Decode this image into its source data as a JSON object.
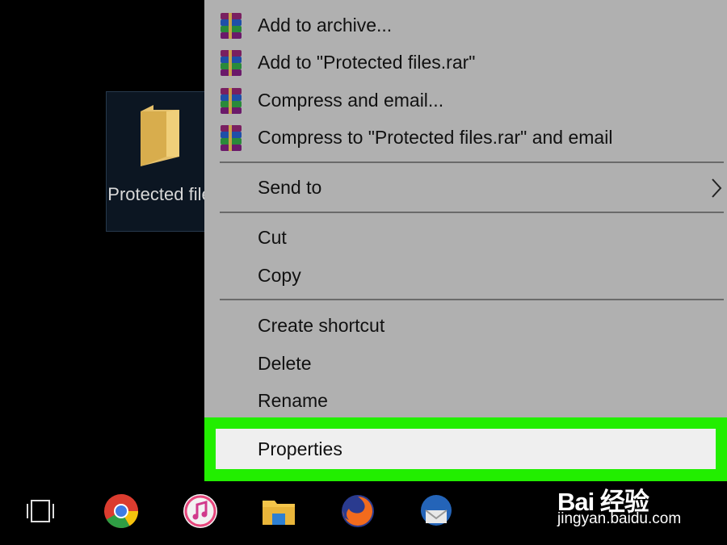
{
  "desktop": {
    "folder": {
      "label": "Protected files",
      "icon": "folder-icon"
    }
  },
  "context_menu": {
    "items": [
      {
        "label": "Add to archive...",
        "icon": "winrar-icon"
      },
      {
        "label": "Add to \"Protected files.rar\"",
        "icon": "winrar-icon"
      },
      {
        "label": "Compress and email...",
        "icon": "winrar-icon"
      },
      {
        "label": "Compress to \"Protected files.rar\" and email",
        "icon": "winrar-icon"
      },
      {
        "label": "Send to",
        "submenu": true,
        "icon": "chevron-right-icon"
      },
      {
        "label": "Cut"
      },
      {
        "label": "Copy"
      },
      {
        "label": "Create shortcut"
      },
      {
        "label": "Delete"
      },
      {
        "label": "Rename"
      },
      {
        "label": "Properties",
        "highlighted": true
      }
    ],
    "highlight_color": "#22ee00"
  },
  "taskbar": {
    "icons": [
      "task-view-icon",
      "chrome-icon",
      "itunes-icon",
      "file-explorer-icon",
      "firefox-icon",
      "thunderbird-icon"
    ]
  },
  "watermark": {
    "brand": "Bai 经验",
    "url": "jingyan.baidu.com"
  }
}
